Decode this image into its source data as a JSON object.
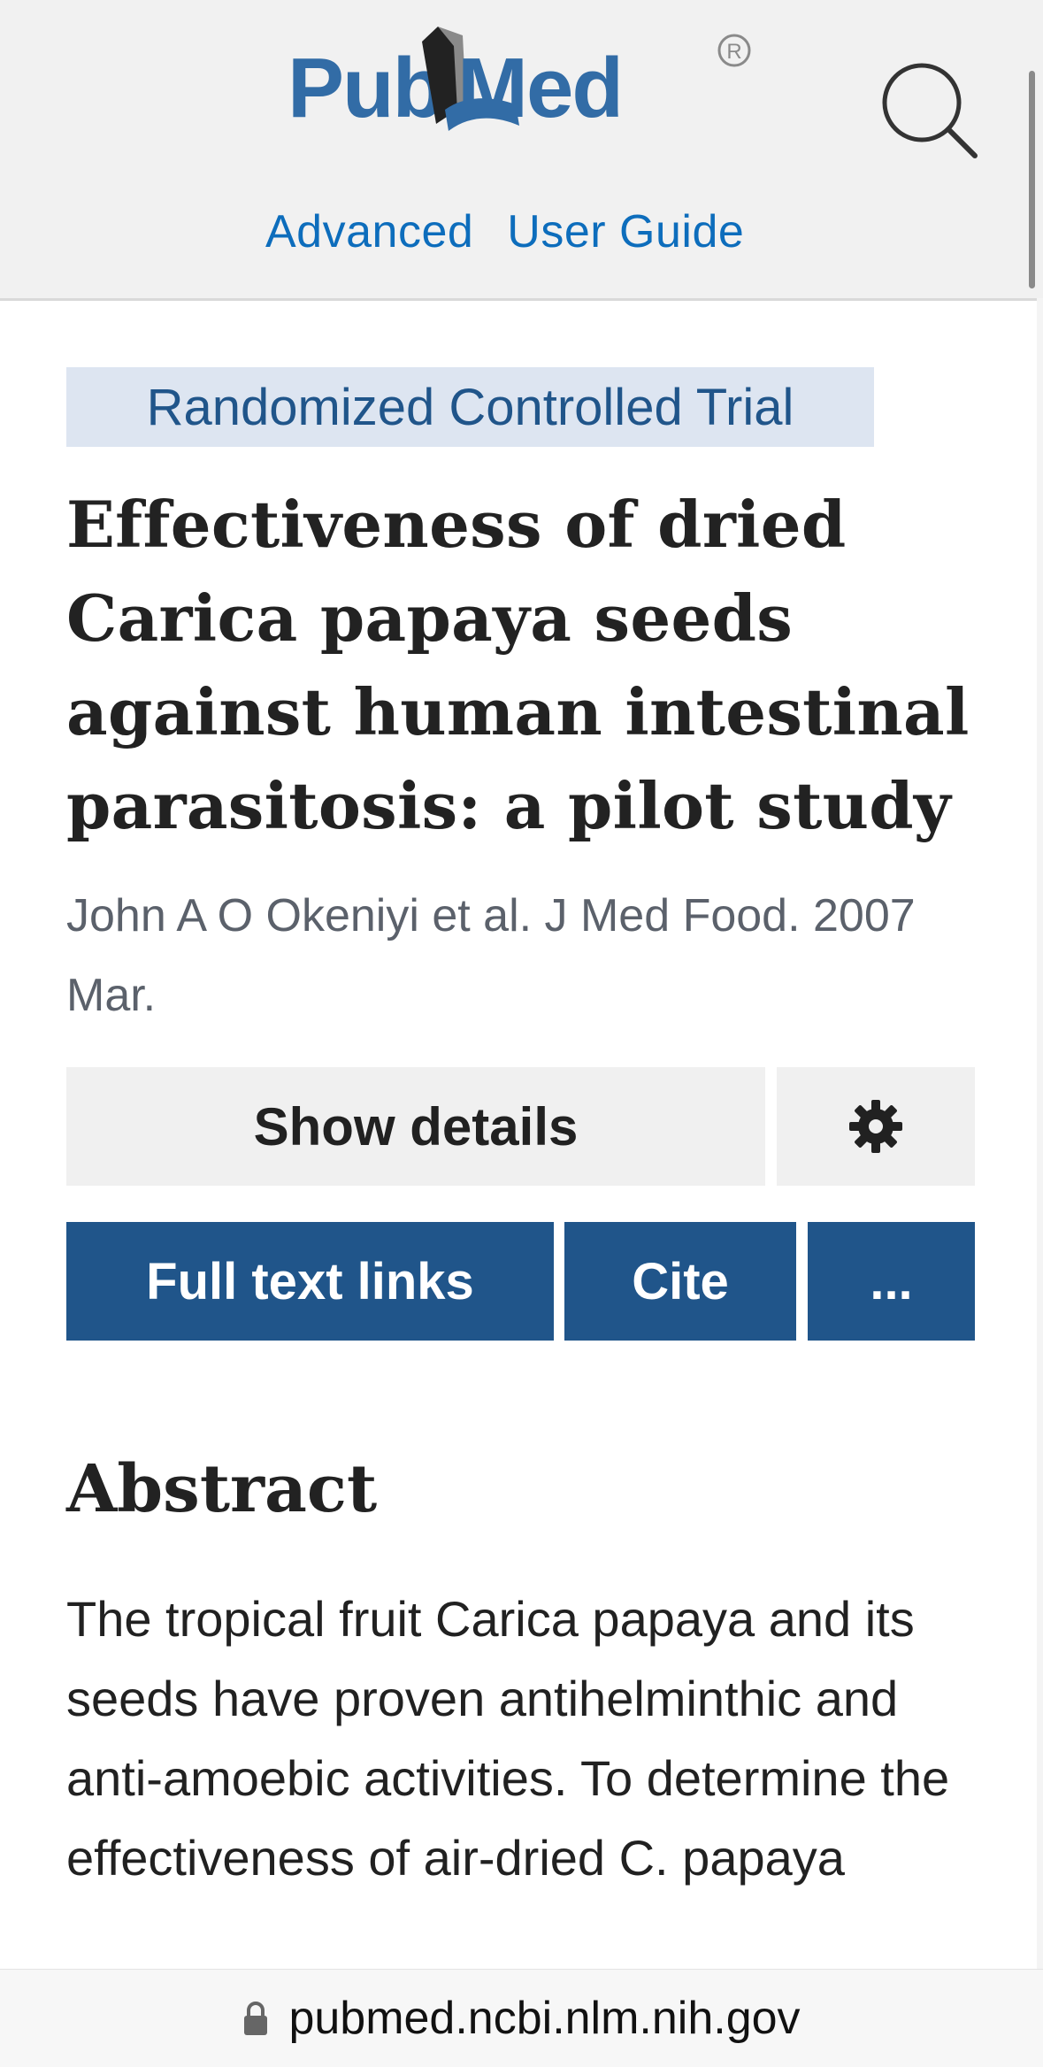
{
  "header": {
    "logo_text": "PubMed",
    "nav": [
      "Advanced",
      "User Guide"
    ]
  },
  "article": {
    "type_badge": "Randomized Controlled Trial",
    "title": "Effectiveness of dried Carica papaya seeds against human intestinal parasitosis: a pilot study",
    "citation": "John A O Okeniyi et al. J Med Food. 2007 Mar.",
    "show_details_label": "Show details",
    "full_text_label": "Full text links",
    "cite_label": "Cite",
    "more_label": "...",
    "abstract_heading": "Abstract",
    "abstract_text": "The tropical fruit Carica papaya and its seeds have proven antihelminthic and anti-amoebic activities. To determine the effectiveness of air-dried C. papaya"
  },
  "browser": {
    "url": "pubmed.ncbi.nlm.nih.gov"
  },
  "colors": {
    "link": "#0d6dbc",
    "primary_button": "#20558a",
    "badge_bg": "#dde5f1"
  },
  "icons": {
    "search": "magnifier-icon",
    "settings": "gear-icon",
    "lock": "lock-icon"
  }
}
